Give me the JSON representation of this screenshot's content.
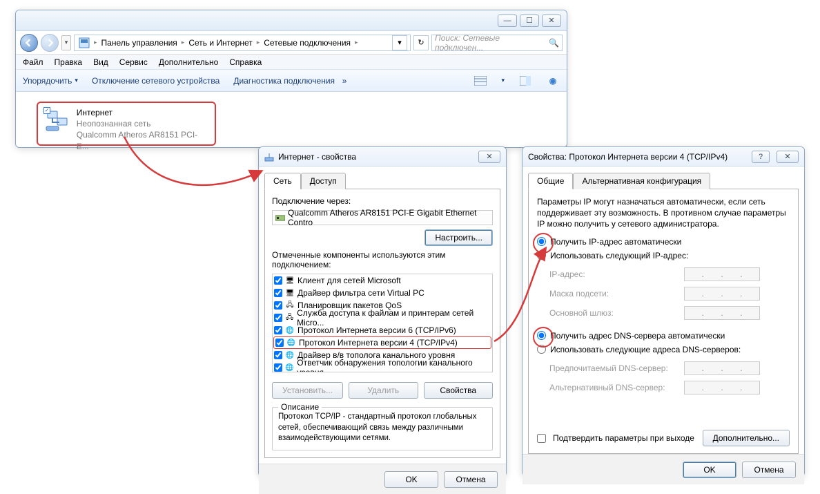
{
  "explorer": {
    "breadcrumb": [
      "Панель управления",
      "Сеть и Интернет",
      "Сетевые подключения"
    ],
    "search_placeholder": "Поиск: Сетевые подключен...",
    "menu": [
      "Файл",
      "Правка",
      "Вид",
      "Сервис",
      "Дополнительно",
      "Справка"
    ],
    "toolbar": {
      "organize": "Упорядочить",
      "disable": "Отключение сетевого устройства",
      "diag": "Диагностика подключения"
    },
    "item": {
      "name": "Интернет",
      "status": "Неопознанная сеть",
      "device": "Qualcomm Atheros AR8151 PCI-E..."
    }
  },
  "props": {
    "title": "Интернет - свойства",
    "tabs": {
      "network": "Сеть",
      "access": "Доступ"
    },
    "connect_via": "Подключение через:",
    "adapter": "Qualcomm Atheros AR8151 PCI-E Gigabit Ethernet Contro",
    "configure_btn": "Настроить...",
    "components_label": "Отмеченные компоненты используются этим подключением:",
    "components": [
      "Клиент для сетей Microsoft",
      "Драйвер фильтра сети Virtual PC",
      "Планировщик пакетов QoS",
      "Служба доступа к файлам и принтерам сетей Micro...",
      "Протокол Интернета версии 6 (TCP/IPv6)",
      "Протокол Интернета версии 4 (TCP/IPv4)",
      "Драйвер в/в тополога канального уровня",
      "Ответчик обнаружения топологии канального уровня"
    ],
    "install_btn": "Установить...",
    "remove_btn": "Удалить",
    "props_btn": "Свойства",
    "desc_title": "Описание",
    "desc_text": "Протокол TCP/IP - стандартный протокол глобальных сетей, обеспечивающий связь между различными взаимодействующими сетями.",
    "ok": "OK",
    "cancel": "Отмена"
  },
  "ipv4": {
    "title": "Свойства: Протокол Интернета версии 4 (TCP/IPv4)",
    "tabs": {
      "general": "Общие",
      "alt": "Альтернативная конфигурация"
    },
    "intro": "Параметры IP могут назначаться автоматически, если сеть поддерживает эту возможность. В противном случае параметры IP можно получить у сетевого администратора.",
    "radio_ip_auto": "Получить IP-адрес автоматически",
    "radio_ip_manual": "Использовать следующий IP-адрес:",
    "ip_label": "IP-адрес:",
    "mask_label": "Маска подсети:",
    "gw_label": "Основной шлюз:",
    "radio_dns_auto": "Получить адрес DNS-сервера автоматически",
    "radio_dns_manual": "Использовать следующие адреса DNS-серверов:",
    "dns1_label": "Предпочитаемый DNS-сервер:",
    "dns2_label": "Альтернативный DNS-сервер:",
    "validate_label": "Подтвердить параметры при выходе",
    "advanced_btn": "Дополнительно...",
    "ok": "OK",
    "cancel": "Отмена"
  }
}
